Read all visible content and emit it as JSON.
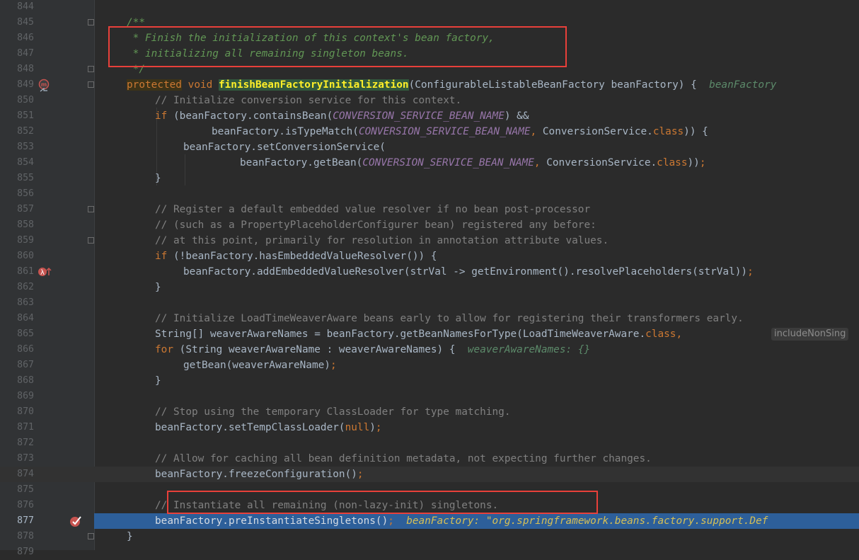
{
  "lines": {
    "l844": {
      "num": "844"
    },
    "l845": {
      "num": "845",
      "t": "/**"
    },
    "l846": {
      "num": "846",
      "t": " * Finish the initialization of this context's bean factory,"
    },
    "l847": {
      "num": "847",
      "t": " * initializing all remaining singleton beans."
    },
    "l848": {
      "num": "848",
      "t": " */"
    },
    "l849": {
      "num": "849",
      "kw1": "protected",
      "kw2": "void",
      "fn": "finishBeanFactoryInitialization",
      "rest": "(ConfigurableListableBeanFactory beanFactory) {",
      "hint": "beanFactory"
    },
    "l850": {
      "num": "850",
      "t": "// Initialize conversion service for this context."
    },
    "l851": {
      "num": "851",
      "kw": "if",
      "a": " (beanFactory.containsBean(",
      "c": "CONVERSION_SERVICE_BEAN_NAME",
      "b": ") &&"
    },
    "l852": {
      "num": "852",
      "a": "beanFactory.isTypeMatch(",
      "c": "CONVERSION_SERVICE_BEAN_NAME",
      "sep": ",",
      "b": " ConversionService.",
      "kw": "class",
      "e": ")) {"
    },
    "l853": {
      "num": "853",
      "t": "beanFactory.setConversionService("
    },
    "l854": {
      "num": "854",
      "a": "beanFactory.getBean(",
      "c": "CONVERSION_SERVICE_BEAN_NAME",
      "sep": ",",
      "b": " ConversionService.",
      "kw": "class",
      "e": "))",
      "semi": ";"
    },
    "l855": {
      "num": "855",
      "t": "}"
    },
    "l856": {
      "num": "856"
    },
    "l857": {
      "num": "857",
      "t": "// Register a default embedded value resolver if no bean post-processor"
    },
    "l858": {
      "num": "858",
      "t": "// (such as a PropertyPlaceholderConfigurer bean) registered any before:"
    },
    "l859": {
      "num": "859",
      "t": "// at this point, primarily for resolution in annotation attribute values."
    },
    "l860": {
      "num": "860",
      "kw": "if",
      "a": " (!beanFactory.hasEmbeddedValueResolver()) {"
    },
    "l861": {
      "num": "861",
      "a": "beanFactory.addEmbeddedValueResolver(strVal -> getEnvironment().resolvePlaceholders(strVal))",
      "semi": ";"
    },
    "l862": {
      "num": "862",
      "t": "}"
    },
    "l863": {
      "num": "863"
    },
    "l864": {
      "num": "864",
      "t": "// Initialize LoadTimeWeaverAware beans early to allow for registering their transformers early."
    },
    "l865": {
      "num": "865",
      "a": "String[] weaverAwareNames = beanFactory.getBeanNamesForType(LoadTimeWeaverAware.",
      "kw": "class",
      "sep": ",",
      "param": "includeNonSing"
    },
    "l866": {
      "num": "866",
      "kw": "for",
      "a": " (String weaverAwareName : weaverAwareNames) {",
      "hint": "weaverAwareNames: {}"
    },
    "l867": {
      "num": "867",
      "a": "getBean(weaverAwareName)",
      "semi": ";"
    },
    "l868": {
      "num": "868",
      "t": "}"
    },
    "l869": {
      "num": "869"
    },
    "l870": {
      "num": "870",
      "t": "// Stop using the temporary ClassLoader for type matching."
    },
    "l871": {
      "num": "871",
      "a": "beanFactory.setTempClassLoader(",
      "kw": "null",
      "b": ")",
      "semi": ";"
    },
    "l872": {
      "num": "872"
    },
    "l873": {
      "num": "873",
      "t": "// Allow for caching all bean definition metadata, not expecting further changes."
    },
    "l874": {
      "num": "874",
      "a": "beanFactory.freezeConfiguration()",
      "semi": ";"
    },
    "l875": {
      "num": "875"
    },
    "l876": {
      "num": "876",
      "t": "// Instantiate all remaining (non-lazy-init) singletons."
    },
    "l877": {
      "num": "877",
      "a": "beanFactory.preInstantiateSingletons()",
      "semi": ";",
      "dbg": "beanFactory: \"org.springframework.beans.factory.support.Def"
    },
    "l878": {
      "num": "878",
      "t": "}"
    },
    "l879": {
      "num": "879"
    }
  },
  "colors": {
    "background": "#2b2b2b",
    "keyword": "#cc7832",
    "comment": "#808080",
    "doc": "#629755",
    "constant": "#9876aa",
    "exec_line": "#2d5f9a",
    "annotation_box": "#e8403a"
  },
  "icons": [
    "method-override-icon",
    "lambda-icon",
    "breakpoint-icon",
    "fold-icon"
  ]
}
